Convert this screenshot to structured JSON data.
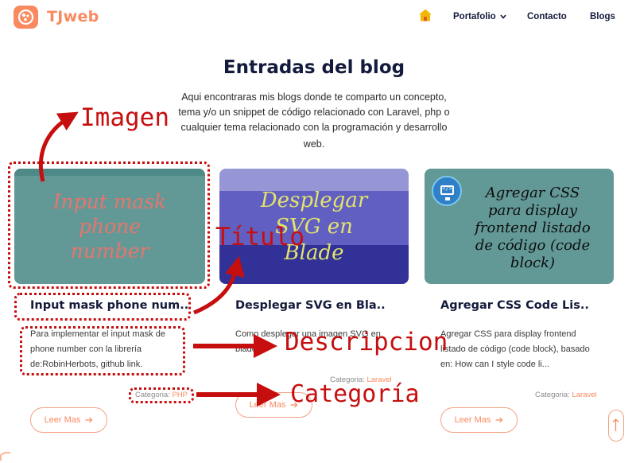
{
  "header": {
    "logo_text": "TJweb",
    "nav": {
      "home_icon": "home-icon",
      "portafolio": "Portafolio",
      "contacto": "Contacto",
      "blogs": "Blogs"
    }
  },
  "hero": {
    "title": "Entradas del blog",
    "intro_lines": [
      "Aqui encontraras mis blogs donde te comparto un concepto,",
      "tema y/o un snippet de código relacionado con Laravel, php o",
      "cualquier tema relacionado con la programación y desarrollo",
      "web."
    ]
  },
  "posts": [
    {
      "image_text": [
        "Input mask",
        "phone",
        "number"
      ],
      "title": "Input mask phone num..",
      "description_lines": [
        "Para implementar el input mask de",
        "phone number con la librería",
        "de:RobinHerbots, github link."
      ],
      "category_label": "Categoria:",
      "category": "PHP",
      "button_label": "Leer Mas"
    },
    {
      "image_text": [
        "Desplegar",
        "SVG en",
        "Blade"
      ],
      "title": "Desplegar SVG en Bla..",
      "description_lines": [
        "Como desplegar una imagen SVG en",
        "blade"
      ],
      "category_label": "Categoria:",
      "category": "Laravel",
      "button_label": "Leer Mas"
    },
    {
      "image_text": [
        "Agregar CSS",
        "para display",
        "frontend listado",
        "de código (code",
        "block)"
      ],
      "title": "Agregar CSS Code Lis..",
      "description_lines": [
        "Agregar CSS para display frontend",
        "listado de código (code block), basado",
        "en: How can I style code li..."
      ],
      "category_label": "Categoria:",
      "category": "Laravel",
      "button_label": "Leer Mas"
    }
  ],
  "annotations": {
    "imagen": "Imagen",
    "titulo": "Título",
    "descripcion": "Descripcion",
    "categoria": "Categoría",
    "color": "#c70e0e"
  },
  "colors": {
    "brand": "#f98a5f",
    "heading": "#141a3b"
  }
}
